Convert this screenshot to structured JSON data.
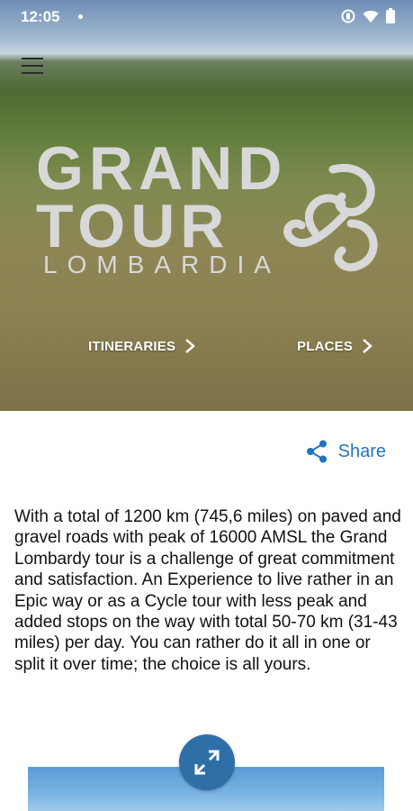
{
  "status_bar": {
    "time": "12:05",
    "icons": [
      "do-not-disturb-icon",
      "wifi-icon",
      "battery-icon"
    ]
  },
  "header": {
    "menu_icon": "hamburger-menu-icon"
  },
  "logo": {
    "line1": "GRAND",
    "line2": "TOUR",
    "line3": "LOMBARDIA"
  },
  "hero_nav": {
    "itineraries_label": "ITINERARIES",
    "places_label": "PLACES"
  },
  "share": {
    "label": "Share",
    "color": "#1f76c2"
  },
  "description": "With a total of 1200 km (745,6 miles) on paved and gravel roads with peak of 16000 AMSL the Grand Lombardy tour is a challenge of great commitment and satisfaction. An Experience to live rather in an Epic way or as a Cycle tour with less peak and added stops on the way with total 50-70 km (31-43 miles) per day. You can rather do it all in one or split it over time; the choice is all yours.",
  "gallery": {
    "expand_icon": "expand-arrows-icon",
    "accent": "#2f6fa8"
  }
}
